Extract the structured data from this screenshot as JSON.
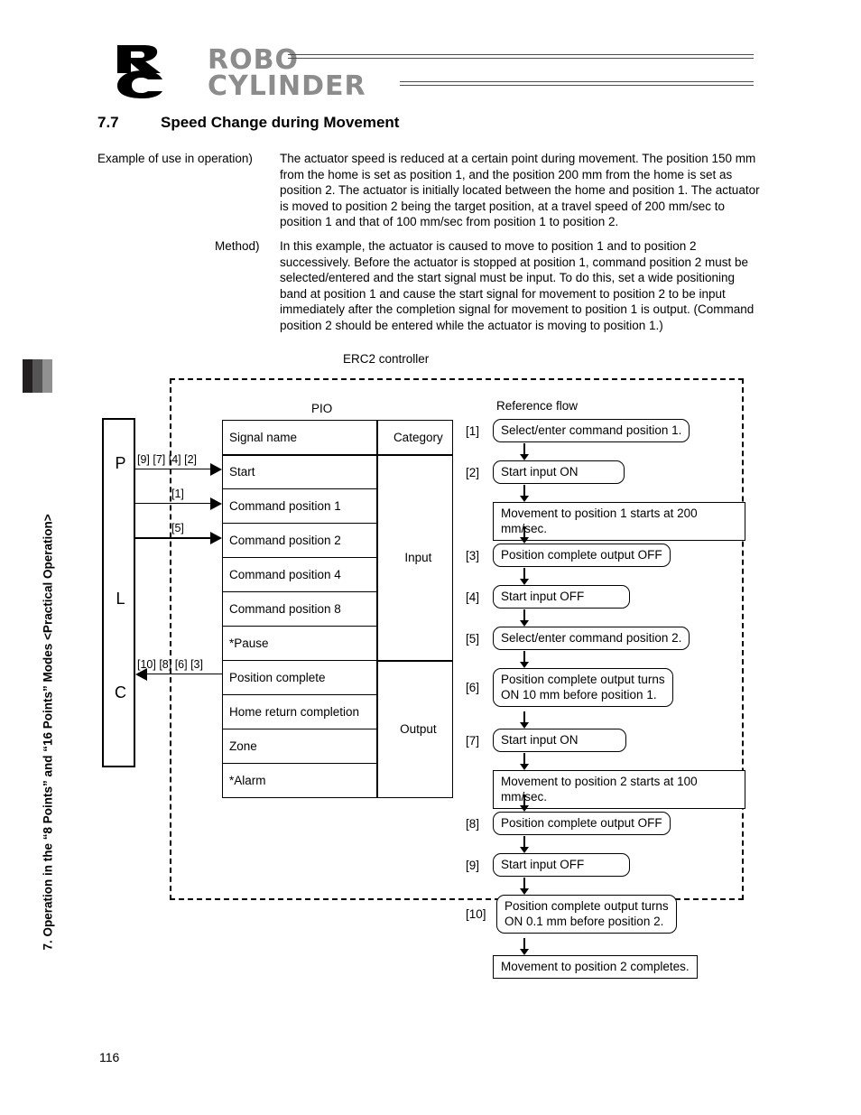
{
  "header": {
    "logo": {
      "mark_alt": "RC",
      "word_line1": "ROBO",
      "word_line2": "CYLINDER"
    }
  },
  "section": {
    "number": "7.7",
    "title": "Speed Change during Movement"
  },
  "paragraphs": [
    {
      "label": "Example of use in operation)",
      "body": "The actuator speed is reduced at a certain point during movement.\nThe position 150 mm from the home is set as position 1, and the position 200 mm from the home is set as position 2. The actuator is initially located between the home and position 1. The actuator is moved to position 2 being the target position, at a travel speed of 200 mm/sec to position 1 and that of 100 mm/sec from position 1 to position 2."
    },
    {
      "label": "Method)",
      "body": "In this example, the actuator is caused to move to position 1 and to position 2 successively. Before the actuator is stopped at position 1, command position 2 must be selected/entered and the start signal must be input. To do this, set a wide positioning band at position 1 and cause the start signal for movement to position 2 to be input immediately after the completion signal for movement to position 1 is output. (Command position 2 should be entered while the actuator is moving to position 1.)"
    }
  ],
  "sidebar": {
    "vertical_text": "7. Operation in the “8 Points” and “16 Points” Modes <Practical Operation>",
    "tab_colors": [
      "#211f1f",
      "#555555",
      "#919191"
    ]
  },
  "diagram": {
    "controller_label": "ERC2 controller",
    "pio_label": "PIO",
    "reference_flow_label": "Reference flow",
    "plc": {
      "letters": [
        "P",
        "L",
        "C"
      ]
    },
    "signal_arrows": [
      {
        "tag": "[9] [7] [4] [2]",
        "direction": "right"
      },
      {
        "tag": "[1]",
        "direction": "right"
      },
      {
        "tag": "[5]",
        "direction": "right"
      },
      {
        "tag": "[10] [8] [6] [3]",
        "direction": "left"
      }
    ],
    "table": {
      "headers": [
        "Signal name",
        "Category"
      ],
      "rows": [
        {
          "signal": "Start",
          "category": "Input"
        },
        {
          "signal": "Command position 1",
          "category": ""
        },
        {
          "signal": "Command position 2",
          "category": ""
        },
        {
          "signal": "Command position 4",
          "category": ""
        },
        {
          "signal": "Command position 8",
          "category": ""
        },
        {
          "signal": "*Pause",
          "category": ""
        },
        {
          "signal": "Position complete",
          "category": "Output"
        },
        {
          "signal": "Home return completion",
          "category": ""
        },
        {
          "signal": "Zone",
          "category": ""
        },
        {
          "signal": "*Alarm",
          "category": ""
        }
      ],
      "category_input": "Input",
      "category_output": "Output"
    },
    "flow_steps": [
      {
        "index": "[1]",
        "text": "Select/enter command position 1.",
        "shape": "round"
      },
      {
        "index": "[2]",
        "text": "Start input ON",
        "shape": "round"
      },
      {
        "index": "",
        "text": "Movement to position 1 starts at 200 mm/sec.",
        "shape": "rect"
      },
      {
        "index": "[3]",
        "text": "Position complete output OFF",
        "shape": "round"
      },
      {
        "index": "[4]",
        "text": "Start input OFF",
        "shape": "round"
      },
      {
        "index": "[5]",
        "text": "Select/enter command position 2.",
        "shape": "round"
      },
      {
        "index": "[6]",
        "text": "Position complete output turns\nON 10 mm before position 1.",
        "shape": "round"
      },
      {
        "index": "[7]",
        "text": "Start input ON",
        "shape": "round"
      },
      {
        "index": "",
        "text": "Movement to position 2 starts at 100 mm/sec.",
        "shape": "rect"
      },
      {
        "index": "[8]",
        "text": "Position complete output OFF",
        "shape": "round"
      },
      {
        "index": "[9]",
        "text": "Start input OFF",
        "shape": "round"
      },
      {
        "index": "[10]",
        "text": "Position complete output turns\nON 0.1 mm before position 2.",
        "shape": "round"
      },
      {
        "index": "",
        "text": "Movement to position 2 completes.",
        "shape": "rect"
      }
    ]
  },
  "footer": {
    "page_number": "116"
  }
}
